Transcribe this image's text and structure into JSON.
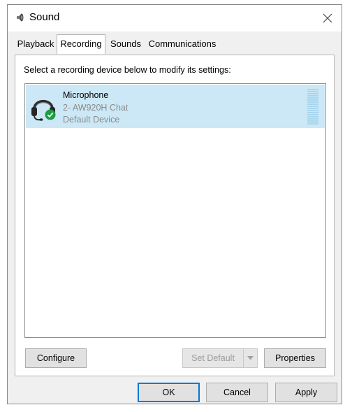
{
  "window": {
    "title": "Sound",
    "icon": "speaker-icon",
    "close_icon": "close-icon"
  },
  "tabs": [
    {
      "label": "Playback",
      "active": false
    },
    {
      "label": "Recording",
      "active": true
    },
    {
      "label": "Sounds",
      "active": false
    },
    {
      "label": "Communications",
      "active": false
    }
  ],
  "panel": {
    "instruction": "Select a recording device below to modify its settings:"
  },
  "devices": [
    {
      "name": "Microphone",
      "description": "2- AW920H Chat",
      "status": "Default Device",
      "icon": "headset-icon",
      "badge_icon": "check-badge-icon",
      "selected": true
    }
  ],
  "panel_buttons": {
    "configure": "Configure",
    "set_default": "Set Default",
    "properties": "Properties"
  },
  "dialog_buttons": {
    "ok": "OK",
    "cancel": "Cancel",
    "apply": "Apply"
  },
  "colors": {
    "selection": "#cce8f7",
    "default_button_border": "#0078d7",
    "check_badge": "#1a9e3f"
  }
}
